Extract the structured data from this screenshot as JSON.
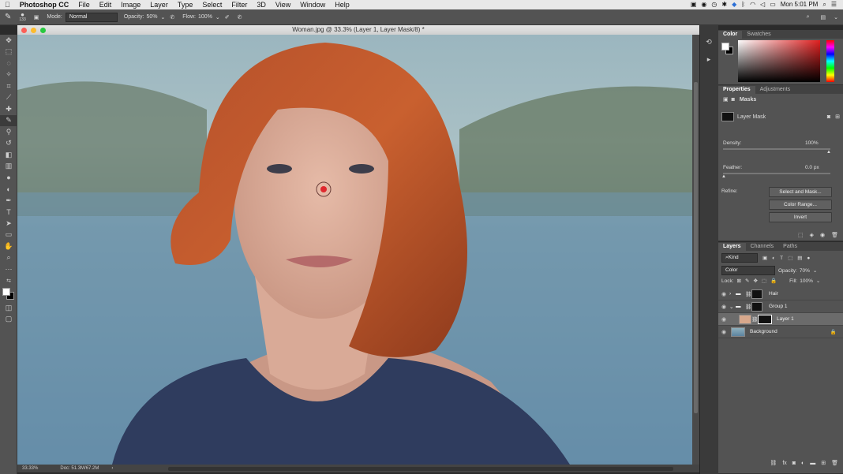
{
  "menubar": {
    "apple": "",
    "app": "Photoshop CC",
    "items": [
      "File",
      "Edit",
      "Image",
      "Layer",
      "Type",
      "Select",
      "Filter",
      "3D",
      "View",
      "Window",
      "Help"
    ],
    "clock": "Mon 5:01 PM"
  },
  "options": {
    "brush_size": "133",
    "mode_label": "Mode:",
    "mode_value": "Normal",
    "opacity_label": "Opacity:",
    "opacity_value": "50%",
    "flow_label": "Flow:",
    "flow_value": "100%"
  },
  "document": {
    "title": "Woman.jpg @ 33.3% (Layer 1, Layer Mask/8) *",
    "zoom": "33.33%",
    "doc_size": "Doc: 51.3M/67.2M"
  },
  "color_panel": {
    "tabs": [
      "Color",
      "Swatches"
    ]
  },
  "properties": {
    "tabs": [
      "Properties",
      "Adjustments"
    ],
    "section": "Masks",
    "mask_type": "Layer Mask",
    "density_label": "Density:",
    "density_value": "100%",
    "density_level": 1.0,
    "feather_label": "Feather:",
    "feather_value": "0.0 px",
    "feather_level": 0.0,
    "refine_label": "Refine:",
    "buttons": [
      "Select and Mask...",
      "Color Range...",
      "Invert"
    ]
  },
  "layers_panel": {
    "tabs": [
      "Layers",
      "Channels",
      "Paths"
    ],
    "filter": "Kind",
    "blend_mode": "Color",
    "opacity_label": "Opacity:",
    "opacity_value": "70%",
    "lock_label": "Lock:",
    "fill_label": "Fill:",
    "fill_value": "100%",
    "layers": [
      {
        "name": "Hair"
      },
      {
        "name": "Group 1"
      },
      {
        "name": "Layer 1"
      },
      {
        "name": "Background"
      }
    ]
  },
  "colors": {
    "ui_dark": "#535353",
    "swatch_layer1": "#d8a88c",
    "brush_cursor": "#e0282e"
  }
}
